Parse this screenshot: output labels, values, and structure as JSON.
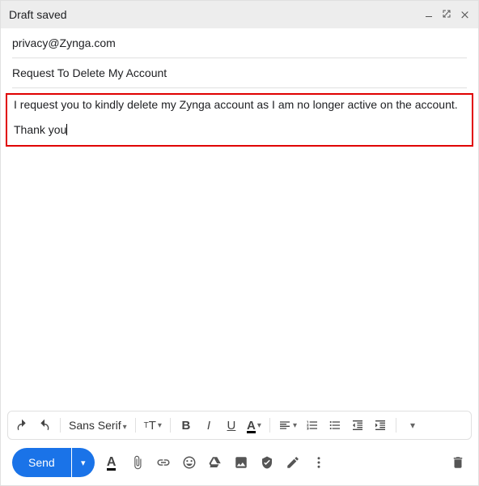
{
  "header": {
    "title": "Draft saved"
  },
  "fields": {
    "to": "privacy@Zynga.com",
    "subject": "Request To Delete My Account"
  },
  "body": {
    "line1": "I request you to kindly delete my Zynga account as I am no longer active on the account.",
    "line2": "Thank you"
  },
  "format": {
    "font_name": "Sans Serif"
  },
  "actions": {
    "send_label": "Send"
  }
}
